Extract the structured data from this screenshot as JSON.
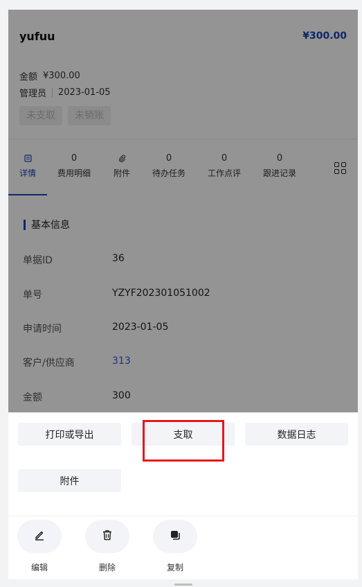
{
  "header": {
    "title": "yufuu",
    "total": "¥300.00",
    "amount_label": "金额",
    "amount_value": "¥300.00",
    "role": "管理员",
    "date": "2023-01-05",
    "tags": [
      "未支取",
      "未销账"
    ]
  },
  "tabs": [
    {
      "count": "",
      "label": "详情",
      "icon": "detail-icon"
    },
    {
      "count": "0",
      "label": "费用明细"
    },
    {
      "count": "",
      "label": "附件",
      "icon": "paperclip-icon"
    },
    {
      "count": "0",
      "label": "待办任务"
    },
    {
      "count": "0",
      "label": "工作点评"
    },
    {
      "count": "0",
      "label": "跟进记录"
    }
  ],
  "section": {
    "title": "基本信息",
    "fields": [
      {
        "label": "单据ID",
        "value": "36"
      },
      {
        "label": "单号",
        "value": "YZYF202301051002"
      },
      {
        "label": "申请时间",
        "value": "2023-01-05"
      },
      {
        "label": "客户/供应商",
        "value": "313"
      },
      {
        "label": "金额",
        "value": "300"
      }
    ]
  },
  "sheet": {
    "buttons": [
      "打印或导出",
      "支取",
      "数据日志",
      "附件"
    ],
    "actions": [
      {
        "label": "编辑",
        "icon": "edit-icon"
      },
      {
        "label": "删除",
        "icon": "trash-icon"
      },
      {
        "label": "复制",
        "icon": "copy-icon"
      }
    ]
  },
  "colors": {
    "accent": "#1a44b8",
    "link": "#2b58d6",
    "highlight": "#e8161b"
  }
}
